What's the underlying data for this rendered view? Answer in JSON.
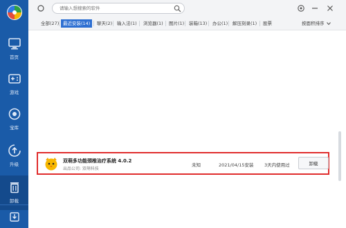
{
  "sidebar": {
    "items": [
      {
        "label": "首页",
        "icon": "monitor-icon"
      },
      {
        "label": "游戏",
        "icon": "gamepad-icon"
      },
      {
        "label": "宝库",
        "icon": "treasure-icon"
      },
      {
        "label": "升级",
        "icon": "upgrade-icon"
      },
      {
        "label": "卸载",
        "icon": "trash-icon"
      }
    ],
    "active": "卸载",
    "download_icon": "download-icon"
  },
  "search": {
    "placeholder": "请输入想搜索的软件"
  },
  "tabs": [
    {
      "label": "全部(27)"
    },
    {
      "label": "最近安装(14)",
      "active": true
    },
    {
      "label": "聊天(2)"
    },
    {
      "label": "输入法(1)"
    },
    {
      "label": "浏览器(1)"
    },
    {
      "label": "图片(1)"
    },
    {
      "label": "装箱(13)"
    },
    {
      "label": "办公(1)"
    },
    {
      "label": "解压刻录(1)"
    },
    {
      "label": "股票"
    }
  ],
  "sort": {
    "label": "按面积排序"
  },
  "app": {
    "name": "双萌多功能颈椎治疗系统 4.0.2",
    "publisher": "出品公司: 双萌科技",
    "size": "未知",
    "install_date": "2021/04/15安装",
    "usage": "3天内使用过",
    "uninstall_label": "卸载"
  },
  "colors": {
    "sidebar": "#1a5ba8",
    "accent": "#2d6fd2",
    "highlight_border": "#e02b2b"
  }
}
